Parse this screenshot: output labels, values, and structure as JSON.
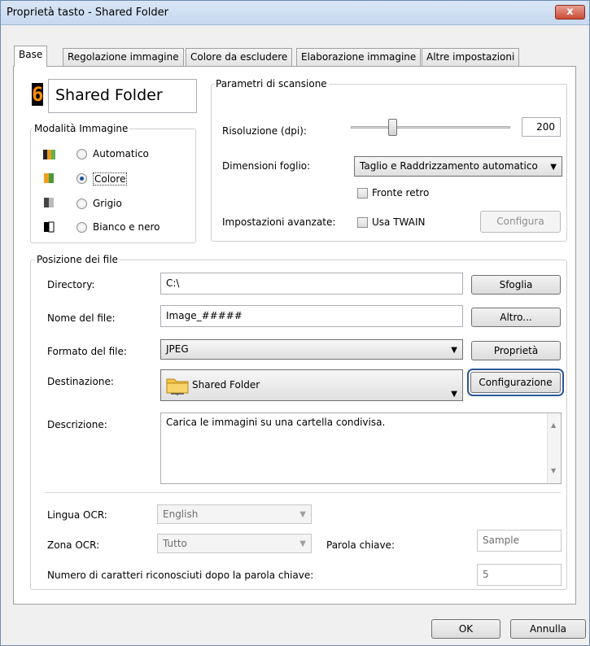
{
  "window": {
    "title": "Proprietà tasto - Shared Folder",
    "close_label": "x"
  },
  "tabs": [
    {
      "label": "Base"
    },
    {
      "label": "Regolazione immagine"
    },
    {
      "label": "Colore da escludere"
    },
    {
      "label": "Elaborazione immagine"
    },
    {
      "label": "Altre impostazioni"
    }
  ],
  "button_display": {
    "digit": "6",
    "name": "Shared Folder"
  },
  "image_mode": {
    "title": "Modalità Immagine",
    "options": [
      {
        "label": "Automatico",
        "checked": false
      },
      {
        "label": "Colore",
        "checked": true
      },
      {
        "label": "Grigio",
        "checked": false
      },
      {
        "label": "Bianco e nero",
        "checked": false
      }
    ]
  },
  "scan_params": {
    "title": "Parametri di scansione",
    "resolution_label": "Risoluzione (dpi):",
    "resolution_value": "200",
    "paper_size_label": "Dimensioni foglio:",
    "paper_size_value": "Taglio e Raddrizzamento automatico",
    "duplex_label": "Fronte retro",
    "advanced_label": "Impostazioni avanzate:",
    "twain_label": "Usa TWAIN",
    "configure_label": "Configura"
  },
  "file_location": {
    "title": "Posizione dei file",
    "directory_label": "Directory:",
    "directory_value": "C:\\",
    "browse_label": "Sfoglia",
    "filename_label": "Nome del file:",
    "filename_value": "Image_#####",
    "more_label": "Altro...",
    "format_label": "Formato del file:",
    "format_value": "JPEG",
    "properties_label": "Proprietà",
    "destination_label": "Destinazione:",
    "destination_value": "Shared Folder",
    "configuration_label": "Configurazione",
    "description_label": "Descrizione:",
    "description_value": "Carica le immagini su una cartella condivisa.",
    "ocr_language_label": "Lingua OCR:",
    "ocr_language_value": "English",
    "ocr_zone_label": "Zona OCR:",
    "ocr_zone_value": "Tutto",
    "keyword_label": "Parola chiave:",
    "keyword_value": "Sample",
    "char_count_label": "Numero di caratteri riconosciuti dopo la parola chiave:",
    "char_count_value": "5"
  },
  "footer": {
    "ok_label": "OK",
    "cancel_label": "Annulla"
  },
  "colors": {
    "digit": "#ff8c00",
    "accent": "#2b5797"
  }
}
